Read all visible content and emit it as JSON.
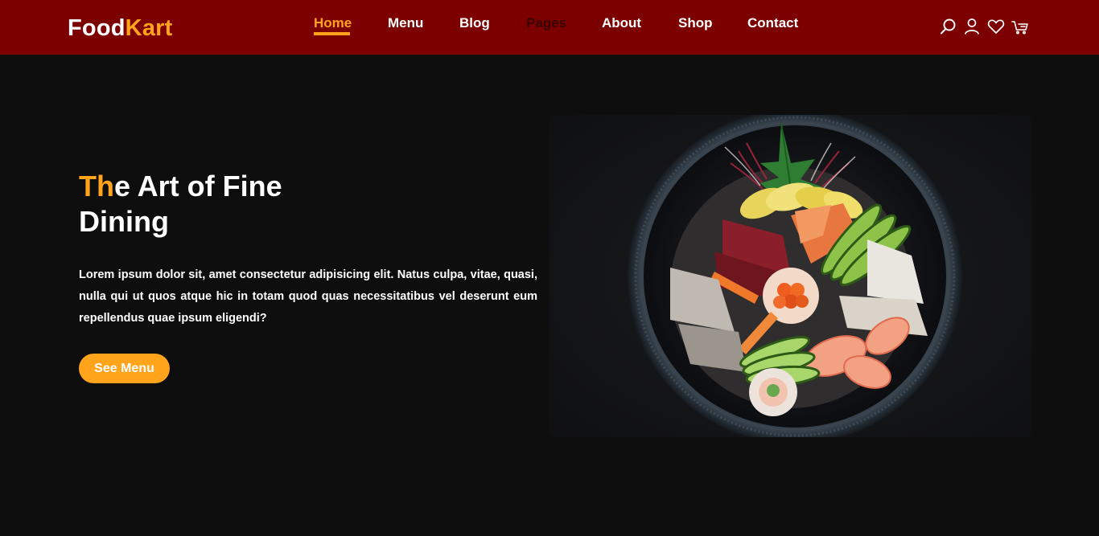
{
  "brand": {
    "name_part1": "Food",
    "name_part2": "Kart",
    "accent_color": "#ffa41b",
    "header_color": "#7d0000"
  },
  "nav": {
    "items": [
      {
        "label": "Home",
        "active": true
      },
      {
        "label": "Menu"
      },
      {
        "label": "Blog"
      },
      {
        "label": "Pages"
      },
      {
        "label": "About"
      },
      {
        "label": "Shop"
      },
      {
        "label": "Contact"
      }
    ]
  },
  "header_icons": [
    "search-icon",
    "user-icon",
    "heart-icon",
    "cart-icon"
  ],
  "hero": {
    "title_accent": "Th",
    "title_rest": "e Art of Fine Dining",
    "description": "Lorem ipsum dolor sit, amet consectetur adipisicing elit. Natus culpa, vitae, quasi, nulla qui ut quos atque hic in totam quod quas necessitatibus vel deserunt eum repellendus quae ipsum eligendi?",
    "button_label": "See Menu",
    "image": "sushi-bowl-photo"
  }
}
